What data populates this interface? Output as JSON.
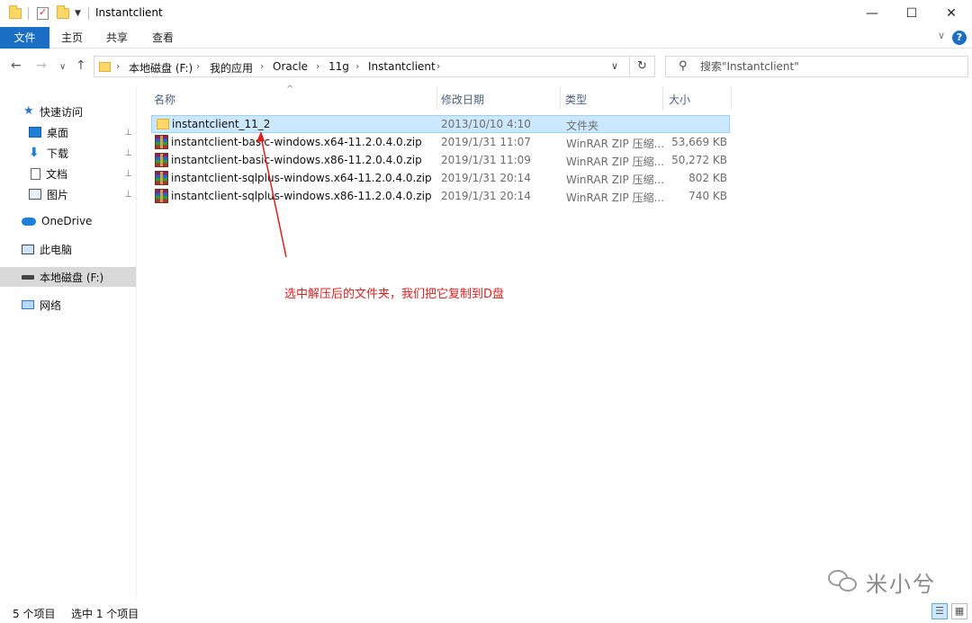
{
  "window": {
    "title": "Instantclient",
    "minimize_glyph": "—",
    "maximize_glyph": "☐",
    "close_glyph": "✕"
  },
  "ribbon": {
    "tabs": [
      {
        "label": "文件",
        "active": true
      },
      {
        "label": "主页",
        "active": false
      },
      {
        "label": "共享",
        "active": false
      },
      {
        "label": "查看",
        "active": false
      }
    ],
    "expand_glyph": "∨",
    "help_glyph": "?"
  },
  "nav": {
    "back_glyph": "←",
    "forward_glyph": "→",
    "recent_glyph": "∨",
    "up_glyph": "↑",
    "breadcrumb": [
      "本地磁盘 (F:)",
      "我的应用",
      "Oracle",
      "11g",
      "Instantclient"
    ],
    "chevron_glyph": "›",
    "dropdown_glyph": "∨",
    "refresh_glyph": "↻"
  },
  "search": {
    "icon": "search-icon",
    "glyph": "⚲",
    "placeholder": "搜索\"Instantclient\""
  },
  "sidebar": {
    "items": [
      {
        "label": "快速访问",
        "icon": "star-icon",
        "pinned": false
      },
      {
        "label": "桌面",
        "icon": "desktop-icon",
        "pinned": true
      },
      {
        "label": "下载",
        "icon": "download-icon",
        "pinned": true
      },
      {
        "label": "文档",
        "icon": "document-icon",
        "pinned": true
      },
      {
        "label": "图片",
        "icon": "pictures-icon",
        "pinned": true
      },
      {
        "label": "OneDrive",
        "icon": "onedrive-icon",
        "pinned": false
      },
      {
        "label": "此电脑",
        "icon": "this-pc-icon",
        "pinned": false
      },
      {
        "label": "本地磁盘 (F:)",
        "icon": "drive-icon",
        "pinned": false,
        "selected": true
      },
      {
        "label": "网络",
        "icon": "network-icon",
        "pinned": false
      }
    ],
    "star_glyph": "★",
    "download_glyph": "⬇",
    "pin_glyph": "📌"
  },
  "columns": {
    "name": "名称",
    "modified": "修改日期",
    "type": "类型",
    "size": "大小",
    "sort_glyph": "^"
  },
  "files": [
    {
      "name": "instantclient_11_2",
      "modified": "2013/10/10 4:10",
      "type": "文件夹",
      "size": "",
      "kind": "folder",
      "selected": true
    },
    {
      "name": "instantclient-basic-windows.x64-11.2.0.4.0.zip",
      "modified": "2019/1/31 11:07",
      "type": "WinRAR ZIP 压缩...",
      "size": "53,669 KB",
      "kind": "zip",
      "selected": false
    },
    {
      "name": "instantclient-basic-windows.x86-11.2.0.4.0.zip",
      "modified": "2019/1/31 11:09",
      "type": "WinRAR ZIP 压缩...",
      "size": "50,272 KB",
      "kind": "zip",
      "selected": false
    },
    {
      "name": "instantclient-sqlplus-windows.x64-11.2.0.4.0.zip",
      "modified": "2019/1/31 20:14",
      "type": "WinRAR ZIP 压缩...",
      "size": "802 KB",
      "kind": "zip",
      "selected": false
    },
    {
      "name": "instantclient-sqlplus-windows.x86-11.2.0.4.0.zip",
      "modified": "2019/1/31 20:14",
      "type": "WinRAR ZIP 压缩...",
      "size": "740 KB",
      "kind": "zip",
      "selected": false
    }
  ],
  "annotation": {
    "text": "选中解压后的文件夹，我们把它复制到D盘",
    "color": "#e02020"
  },
  "watermark": {
    "text": "米小兮"
  },
  "status": {
    "item_count": "5 个项目",
    "selected_count": "选中 1 个项目",
    "details_view_glyph": "☰",
    "icons_view_glyph": "▦"
  },
  "colors": {
    "accent": "#1a6fc4",
    "selection": "#cce8ff",
    "selection_border": "#99d1ff"
  }
}
